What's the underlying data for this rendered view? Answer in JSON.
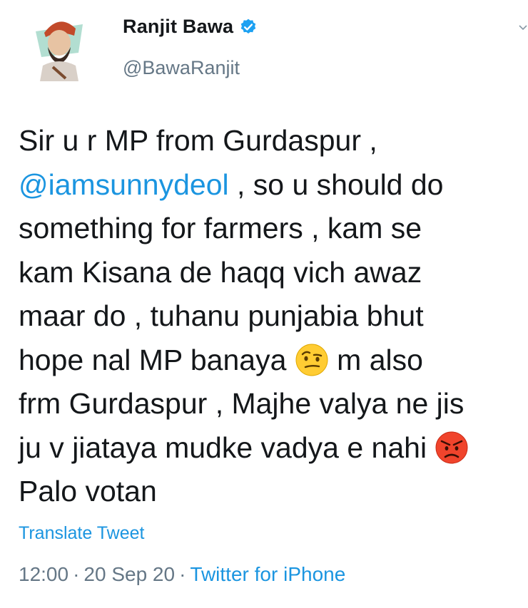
{
  "author": {
    "display_name": "Ranjit Bawa",
    "handle": "@BawaRanjit",
    "verified": true
  },
  "tweet": {
    "line1": "Sir u r MP from Gurdaspur ,",
    "mention": "@iamsunnydeol",
    "line2_rest": " , so u should do",
    "line3": "something for farmers , kam se",
    "line4": "kam Kisana de haqq vich awaz",
    "line5": "maar do , tuhanu punjabia bhut",
    "line6_a": "hope nal MP banaya ",
    "line6_emoji": "face-with-raised-eyebrow-emoji",
    "line6_b": " m also",
    "line7": "frm Gurdaspur , Majhe valya ne jis",
    "line8_a": "ju v jiataya mudke vadya e nahi ",
    "line8_emoji": "angry-face-emoji",
    "line9": "Palo votan"
  },
  "translate_label": "Translate Tweet",
  "meta": {
    "time": "12:00",
    "date": "20 Sep 20",
    "source": "Twitter for iPhone",
    "separator": "·"
  },
  "colors": {
    "link": "#1b95e0",
    "muted": "#657786",
    "text": "#14171a"
  }
}
